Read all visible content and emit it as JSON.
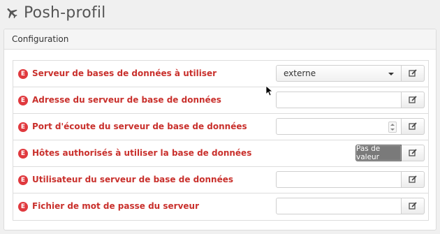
{
  "header": {
    "title": "Posh-profil",
    "icon": "airplane-icon"
  },
  "panel": {
    "heading": "Configuration"
  },
  "badge_text": "E",
  "colors": {
    "accent_red": "#c9302c",
    "badge_red": "#e0393e",
    "default_button": "#7a7a7a"
  },
  "fields": [
    {
      "label": "Serveur de bases de données à utiliser",
      "type": "select",
      "value": "externe"
    },
    {
      "label": "Adresse du serveur de base de données",
      "type": "text",
      "value": ""
    },
    {
      "label": "Port d'écoute du serveur de base de données",
      "type": "number",
      "value": ""
    },
    {
      "label": "Hôtes authorisés à utiliser la base de données",
      "type": "default-button",
      "button_label": "Pas de valeur"
    },
    {
      "label": "Utilisateur du serveur de base de données",
      "type": "text",
      "value": ""
    },
    {
      "label": "Fichier de mot de passe du serveur",
      "type": "text",
      "value": ""
    }
  ]
}
